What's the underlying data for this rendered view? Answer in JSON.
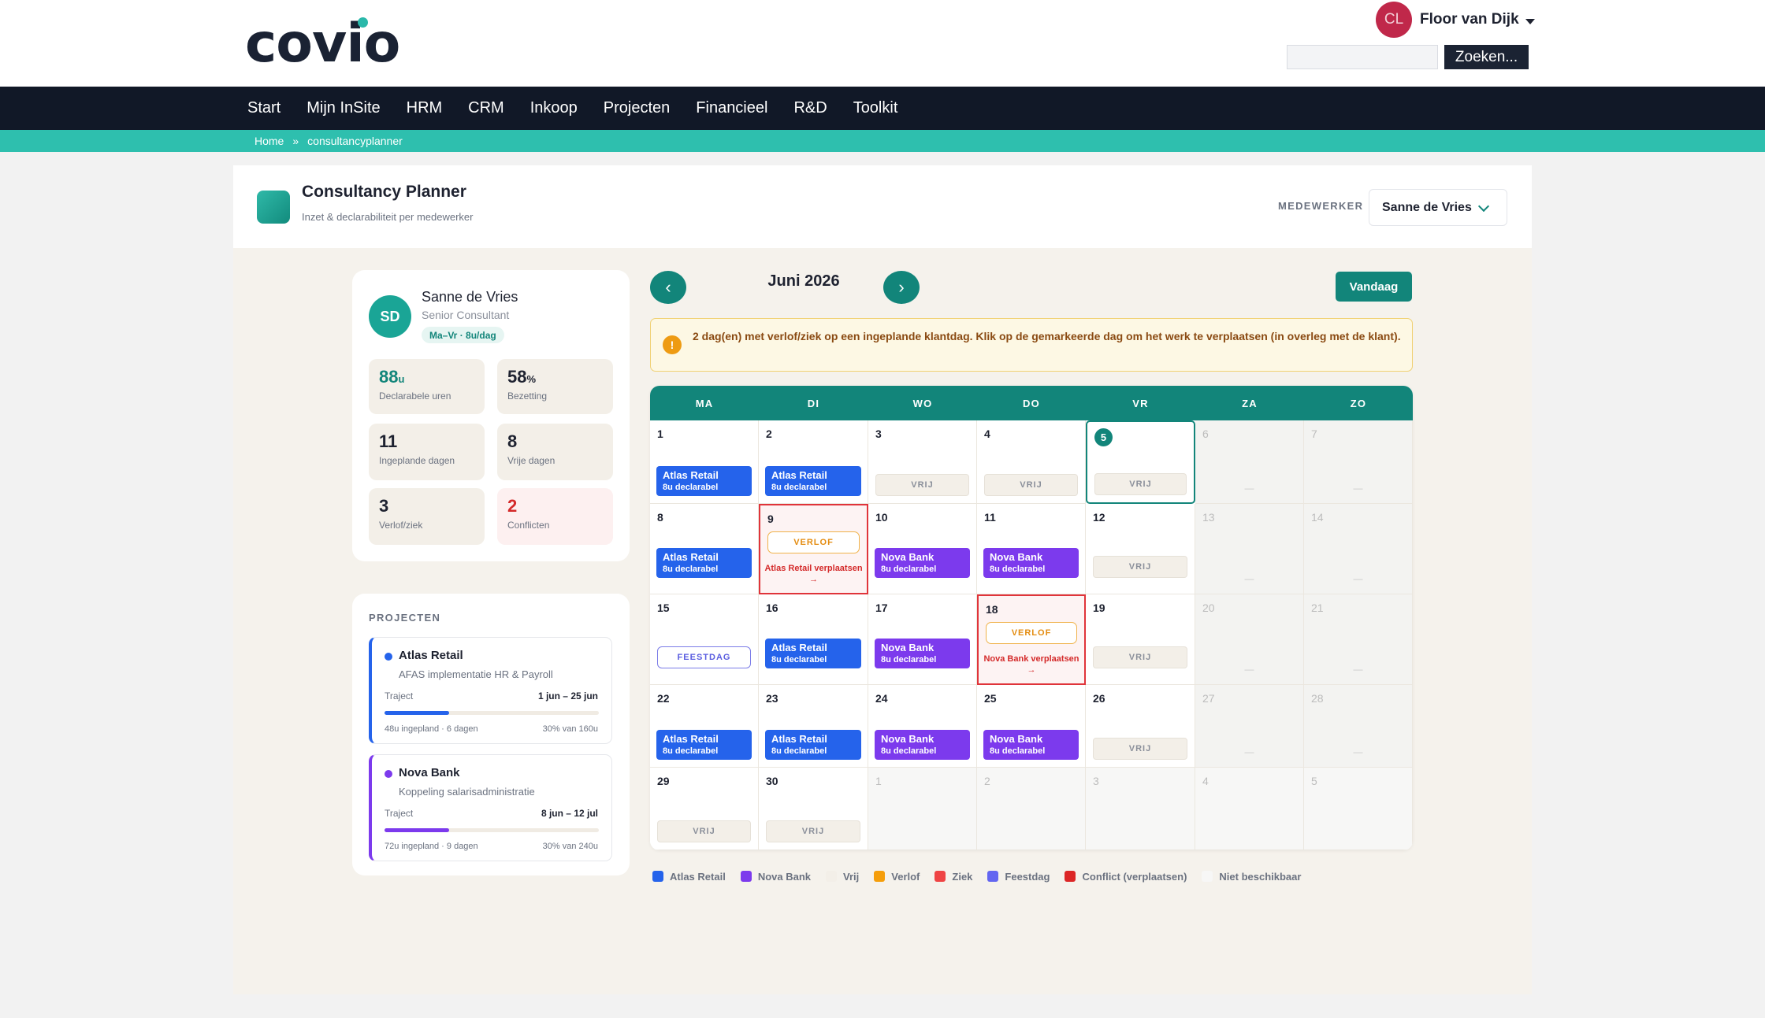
{
  "header": {
    "logo_text": "covio",
    "user_name": "Floor van Dijk",
    "user_initials": "CL",
    "search_placeholder": "",
    "search_button": "Zoeken..."
  },
  "nav": [
    "Start",
    "Mijn InSite",
    "HRM",
    "CRM",
    "Inkoop",
    "Projecten",
    "Financieel",
    "R&D",
    "Toolkit"
  ],
  "breadcrumb": {
    "home": "Home",
    "separator": "»",
    "current": "consultancyplanner"
  },
  "app": {
    "title": "Consultancy Planner",
    "subtitle": "Inzet & declarabiliteit per medewerker",
    "employee_label": "MEDEWERKER",
    "employee_selected": "Sanne de Vries"
  },
  "profile": {
    "initials": "SD",
    "name": "Sanne de Vries",
    "role": "Senior Consultant",
    "schedule": "Ma–Vr · 8u/dag",
    "stats": [
      {
        "value": "88",
        "unit": "u",
        "label": "Declarabele uren"
      },
      {
        "value": "58",
        "unit": "%",
        "label": "Bezetting"
      },
      {
        "value": "11",
        "unit": "",
        "label": "Ingeplande dagen"
      },
      {
        "value": "8",
        "unit": "",
        "label": "Vrije dagen"
      },
      {
        "value": "3",
        "unit": "",
        "label": "Verlof/ziek"
      },
      {
        "value": "2",
        "unit": "",
        "label": "Conflicten"
      }
    ]
  },
  "projects": {
    "heading": "PROJECTEN",
    "traject_label": "Traject",
    "items": [
      {
        "name": "Atlas Retail",
        "desc": "AFAS implementatie HR & Payroll",
        "dates": "1 jun – 25 jun",
        "planned": "48u ingepland · 6 dagen",
        "share": "30% van 160u",
        "progress": 0.3,
        "color": "#2563eb"
      },
      {
        "name": "Nova Bank",
        "desc": "Koppeling salarisadministratie",
        "dates": "8 jun – 12 jul",
        "planned": "72u ingepland · 9 dagen",
        "share": "30% van 240u",
        "progress": 0.3,
        "color": "#7c3aed"
      }
    ]
  },
  "calendar": {
    "month": "Juni 2026",
    "prev_icon": "‹",
    "next_icon": "›",
    "today_button": "Vandaag",
    "alert_icon": "!",
    "alert": "2 dag(en) met verlof/ziek op een ingeplande klantdag. Klik op de gemarkeerde dag om het werk te verplaatsen (in overleg met de klant).",
    "weekdays": [
      "MA",
      "DI",
      "WO",
      "DO",
      "VR",
      "ZA",
      "ZO"
    ],
    "labels": {
      "free": "VRIJ",
      "leave": "VERLOF",
      "holiday": "FEESTDAG",
      "billable": "8u declarabel",
      "empty": "—"
    },
    "weeks": [
      [
        {
          "d": "1",
          "type": "project",
          "project": "Atlas Retail"
        },
        {
          "d": "2",
          "type": "project",
          "project": "Atlas Retail"
        },
        {
          "d": "3",
          "type": "free"
        },
        {
          "d": "4",
          "type": "free"
        },
        {
          "d": "5",
          "type": "free",
          "today": true
        },
        {
          "d": "6",
          "type": "weekend"
        },
        {
          "d": "7",
          "type": "weekend"
        }
      ],
      [
        {
          "d": "8",
          "type": "project",
          "project": "Atlas Retail"
        },
        {
          "d": "9",
          "type": "conflict",
          "move": "Atlas Retail verplaatsen →"
        },
        {
          "d": "10",
          "type": "project",
          "project": "Nova Bank"
        },
        {
          "d": "11",
          "type": "project",
          "project": "Nova Bank"
        },
        {
          "d": "12",
          "type": "free"
        },
        {
          "d": "13",
          "type": "weekend"
        },
        {
          "d": "14",
          "type": "weekend"
        }
      ],
      [
        {
          "d": "15",
          "type": "holiday"
        },
        {
          "d": "16",
          "type": "project",
          "project": "Atlas Retail"
        },
        {
          "d": "17",
          "type": "project",
          "project": "Nova Bank"
        },
        {
          "d": "18",
          "type": "conflict",
          "move": "Nova Bank verplaatsen →"
        },
        {
          "d": "19",
          "type": "free"
        },
        {
          "d": "20",
          "type": "weekend"
        },
        {
          "d": "21",
          "type": "weekend"
        }
      ],
      [
        {
          "d": "22",
          "type": "project",
          "project": "Atlas Retail"
        },
        {
          "d": "23",
          "type": "project",
          "project": "Atlas Retail"
        },
        {
          "d": "24",
          "type": "project",
          "project": "Nova Bank"
        },
        {
          "d": "25",
          "type": "project",
          "project": "Nova Bank"
        },
        {
          "d": "26",
          "type": "free"
        },
        {
          "d": "27",
          "type": "weekend"
        },
        {
          "d": "28",
          "type": "weekend"
        }
      ],
      [
        {
          "d": "29",
          "type": "free"
        },
        {
          "d": "30",
          "type": "free"
        },
        {
          "d": "1",
          "type": "out"
        },
        {
          "d": "2",
          "type": "out"
        },
        {
          "d": "3",
          "type": "out"
        },
        {
          "d": "4",
          "type": "out"
        },
        {
          "d": "5",
          "type": "out"
        }
      ]
    ]
  },
  "legend": [
    {
      "label": "Atlas Retail",
      "color": "#2563eb"
    },
    {
      "label": "Nova Bank",
      "color": "#7c3aed"
    },
    {
      "label": "Vrij",
      "color": "#f3efe8"
    },
    {
      "label": "Verlof",
      "color": "#f59e0b"
    },
    {
      "label": "Ziek",
      "color": "#ef4444"
    },
    {
      "label": "Feestdag",
      "color": "#6366f1"
    },
    {
      "label": "Conflict (verplaatsen)",
      "color": "#dc2626"
    },
    {
      "label": "Niet beschikbaar",
      "color": "#f7f7f6"
    }
  ]
}
